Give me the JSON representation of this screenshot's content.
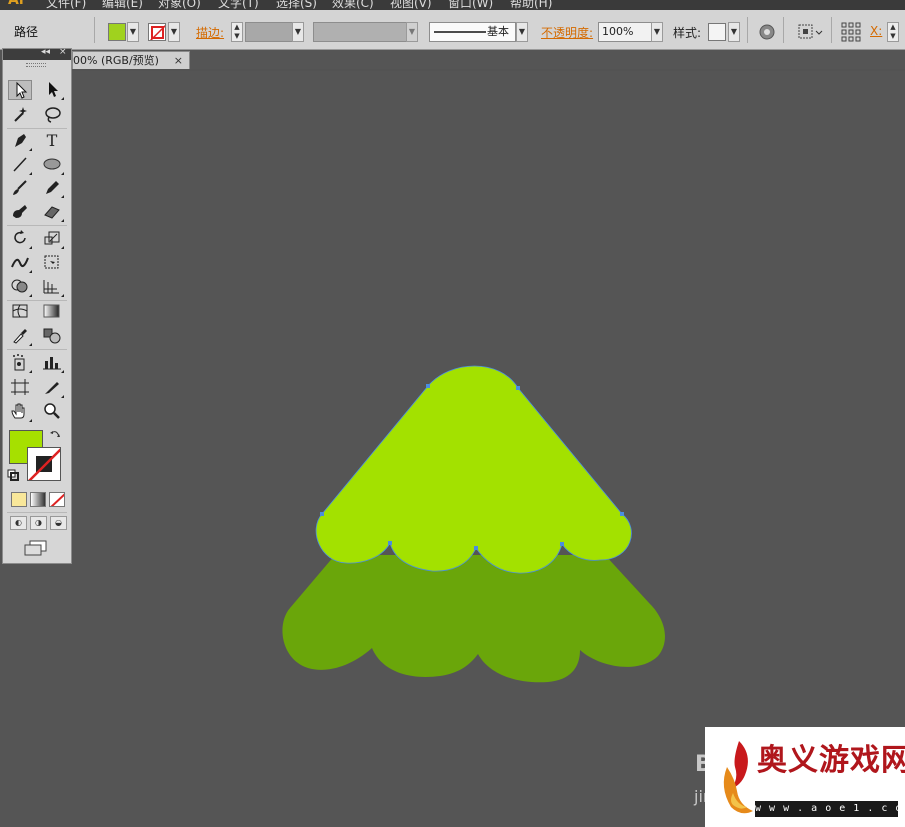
{
  "app": {
    "logo": "Ai",
    "menu": [
      "文件(F)",
      "编辑(E)",
      "对象(O)",
      "文字(T)",
      "选择(S)",
      "效果(C)",
      "视图(V)",
      "窗口(W)",
      "帮助(H)"
    ]
  },
  "control_bar": {
    "selection_type": "路径",
    "fill_color": "#a0d21e",
    "stroke_label": "描边:",
    "stroke_profile": "基本",
    "opacity_label": "不透明度:",
    "opacity_value": "100%",
    "style_label": "样式:",
    "x_label": "X:"
  },
  "document": {
    "tab_title": "00% (RGB/预览)",
    "close_glyph": "×"
  },
  "tools_panel": {
    "collapse_glyph": "◂◂",
    "close_glyph": "×",
    "type_tool_glyph": "T",
    "fill_color": "#a6e000",
    "stroke_color": "none"
  },
  "artwork": {
    "top_layer_color": "#a3e100",
    "bottom_layer_color": "#6aa60a",
    "selection_color": "#4a8ee0"
  },
  "watermark": {
    "partial_left_text": "Bai",
    "partial_left_text2": "jing",
    "name": "奥义游戏网",
    "url": "w w w . a o e 1 . c o m"
  }
}
